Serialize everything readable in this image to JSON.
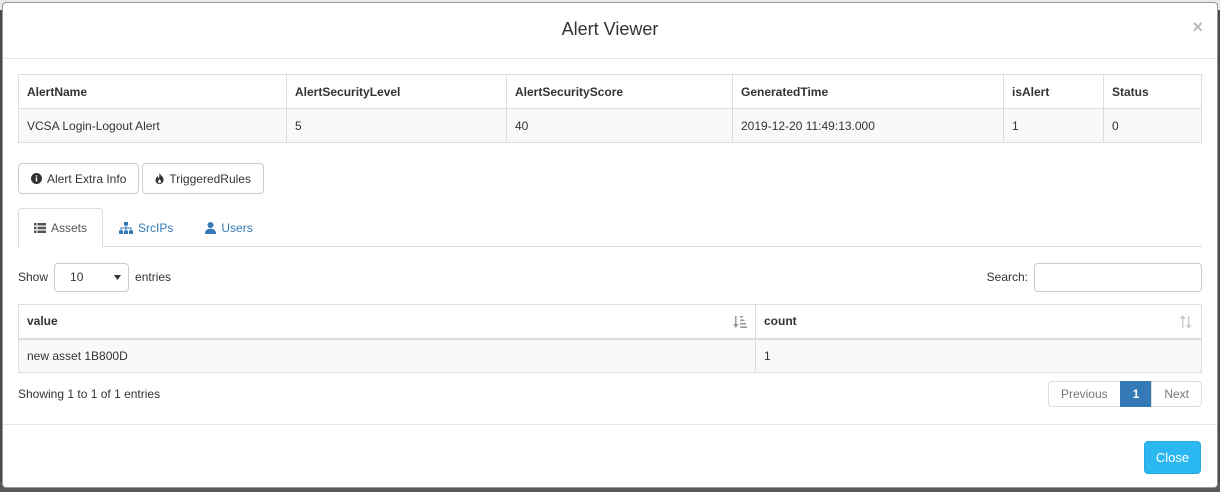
{
  "modal": {
    "title": "Alert Viewer",
    "close_symbol": "×"
  },
  "alert_table": {
    "headers": [
      "AlertName",
      "AlertSecurityLevel",
      "AlertSecurityScore",
      "GeneratedTime",
      "isAlert",
      "Status"
    ],
    "rows": [
      [
        "VCSA Login-Logout Alert",
        "5",
        "40",
        "2019-12-20 11:49:13.000",
        "1",
        "0"
      ]
    ]
  },
  "buttons": {
    "extra_info": {
      "label": "Alert Extra Info",
      "icon": "info-circle-icon"
    },
    "triggered_rules": {
      "label": "TriggeredRules",
      "icon": "fire-icon"
    }
  },
  "tabs": [
    {
      "label": "Assets",
      "icon": "list-icon",
      "active": true
    },
    {
      "label": "SrcIPs",
      "icon": "network-icon",
      "active": false
    },
    {
      "label": "Users",
      "icon": "user-icon",
      "active": false
    }
  ],
  "datatable": {
    "show_label": "Show",
    "length_value": "10",
    "entries_label": "entries",
    "search_label": "Search:",
    "search_value": "",
    "headers": [
      "value",
      "count"
    ],
    "rows": [
      [
        "new asset 1B800D",
        "1"
      ]
    ],
    "info": "Showing 1 to 1 of 1 entries",
    "pagination": {
      "previous": "Previous",
      "current": "1",
      "next": "Next"
    }
  },
  "footer": {
    "close_label": "Close"
  },
  "colors": {
    "primary": "#337ab7",
    "close_button": "#2bb8f0"
  }
}
